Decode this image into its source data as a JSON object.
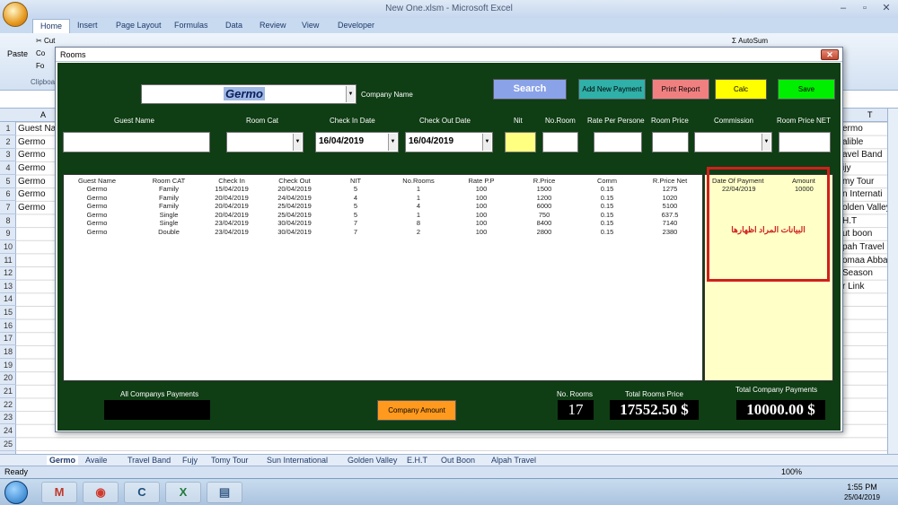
{
  "window": {
    "title": "New One.xlsm - Microsoft Excel"
  },
  "ribbon": {
    "tabs": [
      "Home",
      "Insert",
      "Page Layout",
      "Formulas",
      "Data",
      "Review",
      "View",
      "Developer"
    ],
    "clipboard": {
      "paste": "Paste",
      "cut": "Cut",
      "copy": "Co",
      "format": "Fo",
      "group": "Clipboa"
    },
    "autosum": "AutoSum"
  },
  "columns": {
    "a": "A",
    "t": "T"
  },
  "rows": [
    "1",
    "2",
    "3",
    "4",
    "5",
    "6",
    "7",
    "8",
    "9",
    "10",
    "11",
    "12",
    "13",
    "14",
    "15",
    "16",
    "17",
    "18",
    "19",
    "20",
    "21",
    "22",
    "23",
    "24",
    "25"
  ],
  "cells_a": [
    "Guest Na",
    "Germo",
    "Germo",
    "Germo",
    "Germo",
    "Germo",
    "Germo"
  ],
  "cells_t": [
    "ermo",
    "alible",
    "avel Band",
    "ijy",
    "my Tour",
    "n Internati",
    "olden Valley",
    "H.T",
    "ut boon",
    "pah Travel",
    "omaa Abbas",
    "Season",
    "r Link"
  ],
  "sheet_tabs": [
    "Germo",
    "Availe",
    "Travel Band",
    "Fujy",
    "Tomy Tour",
    "Sun International",
    "Golden Valley",
    "E.H.T",
    "Out Boon",
    "Alpah Travel"
  ],
  "status": {
    "ready": "Ready",
    "zoom": "100%"
  },
  "clock": {
    "time": "1:55 PM",
    "date": "25/04/2019"
  },
  "dialog": {
    "title": "Rooms",
    "company_value": "Germo",
    "company_label": "Company Name",
    "buttons": {
      "search": "Search",
      "add_payment": "Add New Payment",
      "print": "Print Report",
      "calc": "Calc",
      "save": "Save",
      "company_amount": "Company Amount"
    },
    "fields": {
      "guest_name": "Guest Name",
      "room_cat": "Room Cat",
      "check_in": "Check In Date",
      "check_out": "Check Out Date",
      "nit": "Nit",
      "no_room": "No.Room",
      "rate": "Rate Per Persone",
      "room_price": "Room Price",
      "commission": "Commission",
      "price_net": "Room Price NET"
    },
    "check_in_value": "16/04/2019",
    "check_out_value": "16/04/2019",
    "table": {
      "headers": [
        "Guest Name",
        "Room CAT",
        "Check In",
        "Check Out",
        "NIT",
        "No.Rooms",
        "Rate P.P",
        "R.Price",
        "Comm",
        "R.Price Net"
      ],
      "rows": [
        [
          "Germo",
          "Family",
          "15/04/2019",
          "20/04/2019",
          "5",
          "1",
          "100",
          "1500",
          "0.15",
          "1275"
        ],
        [
          "Germo",
          "Family",
          "20/04/2019",
          "24/04/2019",
          "4",
          "1",
          "100",
          "1200",
          "0.15",
          "1020"
        ],
        [
          "Germo",
          "Family",
          "20/04/2019",
          "25/04/2019",
          "5",
          "4",
          "100",
          "6000",
          "0.15",
          "5100"
        ],
        [
          "Germo",
          "Single",
          "20/04/2019",
          "25/04/2019",
          "5",
          "1",
          "100",
          "750",
          "0.15",
          "637.5"
        ],
        [
          "Germo",
          "Single",
          "23/04/2019",
          "30/04/2019",
          "7",
          "8",
          "100",
          "8400",
          "0.15",
          "7140"
        ],
        [
          "Germo",
          "Double",
          "23/04/2019",
          "30/04/2019",
          "7",
          "2",
          "100",
          "2800",
          "0.15",
          "2380"
        ]
      ]
    },
    "payments": {
      "headers": [
        "Date Of Payment",
        "Amount"
      ],
      "rows": [
        [
          "22/04/2019",
          "10000"
        ]
      ],
      "note": "البيانات المراد اظهارها"
    },
    "totals": {
      "all_payments_label": "All Companys Payments",
      "no_rooms_label": "No. Rooms",
      "no_rooms": "17",
      "total_price_label": "Total Rooms Price",
      "total_price": "17552.50 $",
      "total_payments_label": "Total Company Payments",
      "total_payments": "10000.00 $"
    }
  },
  "colors": {
    "dialog_bg": "#0f3d14",
    "search": "#8aa2e8",
    "add_payment": "#2fb0a8",
    "print": "#f08080",
    "calc": "#ffff00",
    "save": "#00ee00",
    "company_amount": "#ff9a1e",
    "payments_panel": "#ffffc8",
    "highlight": "#d0201c"
  }
}
